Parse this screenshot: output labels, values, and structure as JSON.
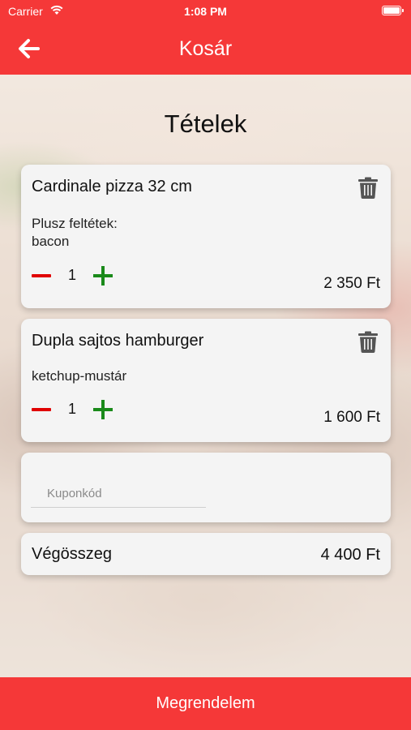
{
  "status_bar": {
    "carrier": "Carrier",
    "time": "1:08 PM"
  },
  "header": {
    "title": "Kosár",
    "back_icon": "arrow-left-icon"
  },
  "section_title": "Tételek",
  "items": [
    {
      "name": "Cardinale pizza 32 cm",
      "extras_label": "Plusz feltétek:",
      "extras_value": "bacon",
      "quantity": "1",
      "price": "2 350 Ft"
    },
    {
      "name": "Dupla sajtos hamburger",
      "extras_value": "ketchup-mustár",
      "quantity": "1",
      "price": "1 600 Ft"
    }
  ],
  "coupon": {
    "placeholder": "Kuponkód",
    "value": ""
  },
  "total": {
    "label": "Végösszeg",
    "value": "4 400 Ft"
  },
  "order_button": {
    "label": "Megrendelem"
  },
  "colors": {
    "accent": "#f53838",
    "minus": "#e00000",
    "plus": "#1a8a1a",
    "card": "#f4f4f4",
    "trash": "#555555"
  }
}
